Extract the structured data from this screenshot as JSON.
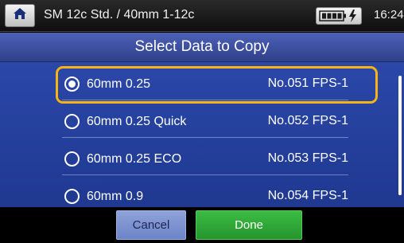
{
  "statusbar": {
    "home_icon": "home-icon",
    "title": "SM 12c Std. / 40mm 1-12c",
    "battery_icon": "battery-charging-icon",
    "time": "16:24"
  },
  "header": {
    "title": "Select Data to Copy"
  },
  "list": {
    "items": [
      {
        "name": "60mm 0.25",
        "number": "No.051 FPS-1",
        "selected": true
      },
      {
        "name": "60mm 0.25 Quick",
        "number": "No.052 FPS-1",
        "selected": false
      },
      {
        "name": "60mm 0.25 ECO",
        "number": "No.053 FPS-1",
        "selected": false
      },
      {
        "name": "60mm 0.9",
        "number": "No.054 FPS-1",
        "selected": false
      }
    ],
    "highlight_color": "#f6b314"
  },
  "buttons": {
    "cancel_label": "Cancel",
    "done_label": "Done"
  },
  "colors": {
    "header": "#3a4ea0",
    "list_bg": "#2440a0",
    "done": "#2fa836",
    "cancel": "#7f94d0"
  }
}
